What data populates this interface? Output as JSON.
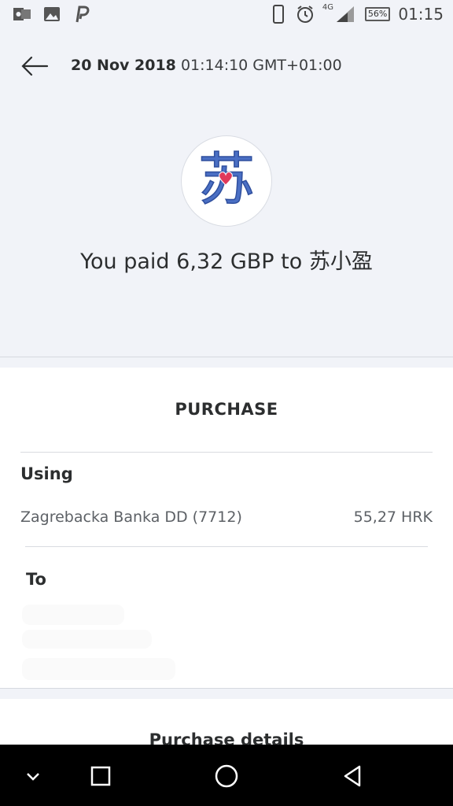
{
  "status_bar": {
    "icons_left": [
      "outlook-icon",
      "image-icon",
      "paypal-icon"
    ],
    "icons_right": [
      "phone-icon",
      "alarm-icon",
      "signal-4g-icon"
    ],
    "network": "4G",
    "battery": "56%",
    "time": "01:15"
  },
  "header": {
    "date": "20 Nov 2018",
    "time": "01:14:10 GMT+01:00"
  },
  "payee": {
    "avatar_char": "苏",
    "headline": "You paid 6,32 GBP to 苏小盈"
  },
  "purchase": {
    "section_title": "PURCHASE",
    "using_label": "Using",
    "funding_source": "Zagrebacka Banka DD (7712)",
    "funding_amount": "55,27 HRK",
    "to_label": "To"
  },
  "details": {
    "title": "Purchase details"
  },
  "colors": {
    "background": "#f1f3f8",
    "text": "#2c2e2f",
    "avatar_char": "#4a6fc4",
    "heart": "#e0395a"
  }
}
